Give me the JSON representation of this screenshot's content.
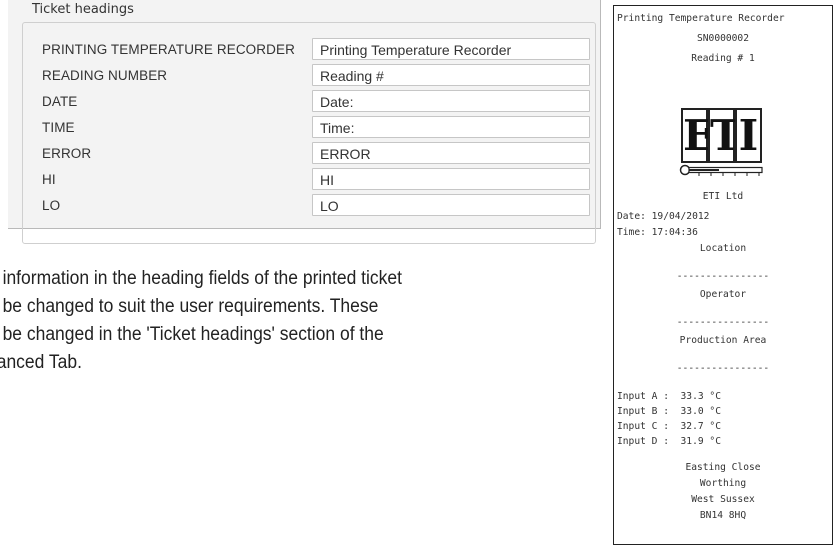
{
  "ticket_headings": {
    "group_title": "Ticket headings",
    "rows": [
      {
        "label": "PRINTING TEMPERATURE RECORDER",
        "value": "Printing Temperature Recorder"
      },
      {
        "label": "READING NUMBER",
        "value": "Reading #"
      },
      {
        "label": "DATE",
        "value": "Date:"
      },
      {
        "label": "TIME",
        "value": "Time:"
      },
      {
        "label": "ERROR",
        "value": "ERROR"
      },
      {
        "label": "HI",
        "value": "HI"
      },
      {
        "label": "LO",
        "value": "LO"
      }
    ]
  },
  "paragraph": {
    "lines": [
      "e information in the heading fields of the printed ticket",
      "n be changed to suit the user requirements. These",
      "n be changed in the 'Ticket headings' section of the",
      "vanced Tab."
    ]
  },
  "ticket": {
    "title": "Printing Temperature Recorder",
    "serial": "SN0000002",
    "reading": "Reading # 1",
    "logo_letters": [
      "E",
      "T",
      "I"
    ],
    "company": "ETI Ltd",
    "date": "Date: 19/04/2012",
    "time": "Time: 17:04:36",
    "location": "Location",
    "divider1": "----------------",
    "operator": "Operator",
    "divider2": "----------------",
    "area": "Production Area",
    "divider3": "----------------",
    "inputs": [
      "Input A :  33.3 °C",
      "Input B :  33.0 °C",
      "Input C :  32.7 °C",
      "Input D :  31.9 °C"
    ],
    "address": [
      "Easting Close",
      "Worthing",
      "West Sussex",
      "BN14 8HQ"
    ]
  },
  "colors": {
    "panel_bg": "#f3f3f3",
    "input_border": "#c6c6c6",
    "ticket_border": "#222222"
  }
}
